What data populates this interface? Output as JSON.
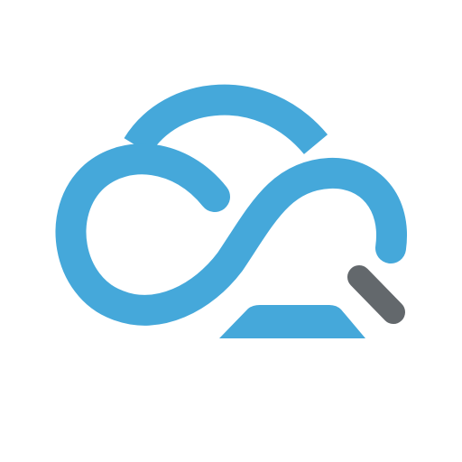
{
  "logo": {
    "icon": "cloud-search-logo-icon",
    "colors": {
      "cloud": "#45a8da",
      "handle": "#63686c",
      "background": "#ffffff"
    }
  }
}
